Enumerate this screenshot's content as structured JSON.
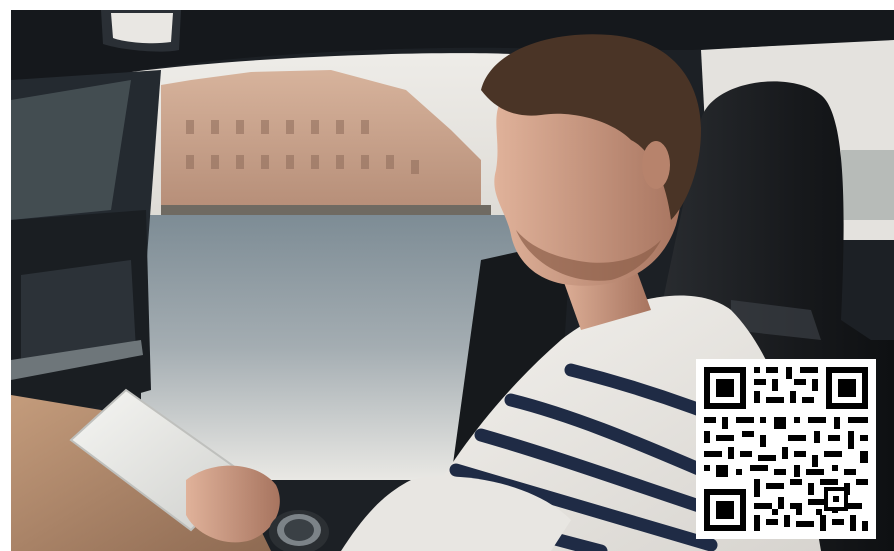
{
  "photo": {
    "subject": "man-in-car-holding-tablet",
    "palette": {
      "car_interior": "#1b1f24",
      "sky": "#e6e4e0",
      "building": "#c9a58e",
      "water": "#8f9ca4",
      "skin": "#c99a82",
      "hair": "#4a3426",
      "sweater": "#eceae6",
      "stripe": "#1e2a44",
      "seat": "#16181b",
      "pants": "#b28a6b"
    }
  },
  "qr_code": {
    "icon": "qr-code-icon",
    "foreground": "#000000",
    "background": "#ffffff"
  }
}
